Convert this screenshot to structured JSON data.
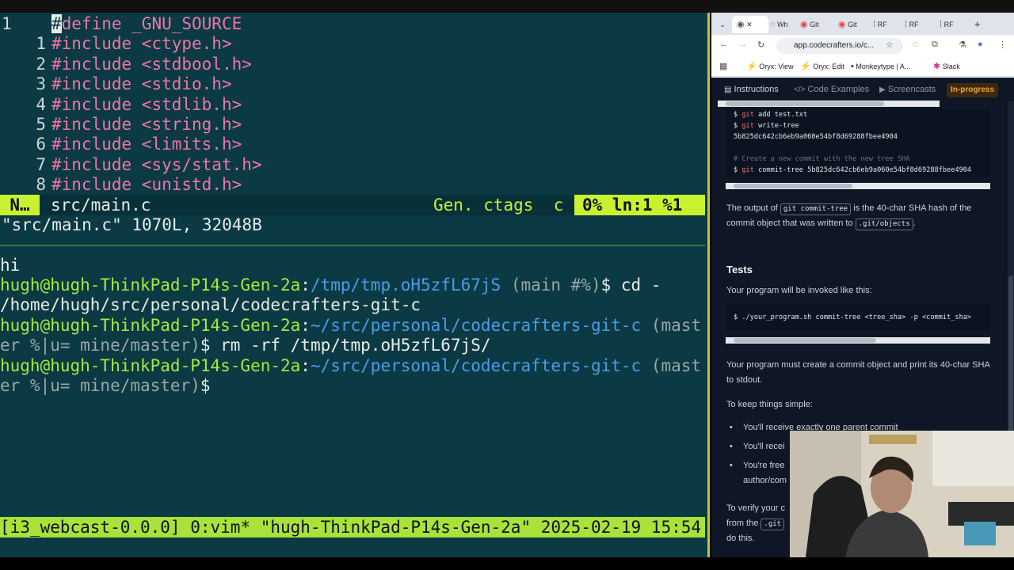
{
  "terminal": {
    "code_lines": [
      {
        "num": "1",
        "text": "#define _GNU_SOURCE",
        "first": true
      },
      {
        "num": "1",
        "directive": "#include",
        "arg": " <ctype.h>"
      },
      {
        "num": "2",
        "directive": "#include",
        "arg": " <stdbool.h>"
      },
      {
        "num": "3",
        "directive": "#include",
        "arg": " <stdio.h>"
      },
      {
        "num": "4",
        "directive": "#include",
        "arg": " <stdlib.h>"
      },
      {
        "num": "5",
        "directive": "#include",
        "arg": " <string.h>"
      },
      {
        "num": "6",
        "directive": "#include",
        "arg": " <limits.h>"
      },
      {
        "num": "7",
        "directive": "#include",
        "arg": " <sys/stat.h>"
      },
      {
        "num": "8",
        "directive": "#include",
        "arg": " <unistd.h>"
      }
    ],
    "statusline": {
      "mode": "N…",
      "file": "src/main.c",
      "right": "Gen. ctags  c",
      "pos": "0% ln:1 %1"
    },
    "cmdline": "\"src/main.c\" 1070L, 32048B",
    "shell": {
      "line_hi": "hi",
      "p1_user": "hugh@hugh-ThinkPad-P14s-Gen-2a",
      "p1_sep": ":",
      "p1_path": "/tmp/tmp.oH5zfL67jS",
      "p1_branch": " (main #%)",
      "p1_cmd": "$ cd -",
      "out1": "/home/hugh/src/personal/codecrafters-git-c",
      "p2_user": "hugh@hugh-ThinkPad-P14s-Gen-2a",
      "p2_sep": ":",
      "p2_path": "~/src/personal/codecrafters-git-c",
      "p2_branch": " (mast",
      "p2_cont": "er %|u= mine/master)",
      "p2_cmd": "$ rm -rf /tmp/tmp.oH5zfL67jS/",
      "p3_user": "hugh@hugh-ThinkPad-P14s-Gen-2a",
      "p3_sep": ":",
      "p3_path": "~/src/personal/codecrafters-git-c",
      "p3_branch": " (mast",
      "p3_cont": "er %|u= mine/master)",
      "p3_cmd": "$"
    },
    "tmux_status": "[i3_webcast-0.0.0] 0:vim* \"hugh-ThinkPad-P14s-Gen-2a\" 2025-02-19 15:54"
  },
  "browser": {
    "tabs": [
      "Wh",
      "Git",
      "Git",
      "RF",
      "RF",
      "RF"
    ],
    "new_tab": "+",
    "url": "app.codecrafters.io/c...",
    "bookmarks": [
      "Oryx: View",
      "Oryx: Edit",
      "Monkeytype | A...",
      "Slack"
    ],
    "page_tabs": [
      "Instructions",
      "Code Examples",
      "Screencasts"
    ],
    "status_badge": "In-progress",
    "code1": [
      {
        "kind": "cmd",
        "prefix": "$ ",
        "git": "git",
        "rest": " add test.txt"
      },
      {
        "kind": "cmd",
        "prefix": "$ ",
        "git": "git",
        "rest": " write-tree"
      },
      {
        "kind": "out",
        "text": "5b825dc642cb6eb9a060e54bf8d69288fbee4904"
      },
      {
        "kind": "blank",
        "text": ""
      },
      {
        "kind": "comment",
        "text": "# Create a new commit with the new tree SHA"
      },
      {
        "kind": "cmd",
        "prefix": "$ ",
        "git": "git",
        "rest": " commit-tree 5b825dc642cb6eb9a060e54bf8d69288fbee4904"
      }
    ],
    "para1_a": "The output of ",
    "para1_code": "git commit-tree",
    "para1_b": " is the 40-char SHA hash of the commit object that was written to ",
    "para1_code2": ".git/objects",
    "para1_c": ".",
    "tests_heading": "Tests",
    "tests_intro": "Your program will be invoked like this:",
    "invocation": "$ ./your_program.sh commit-tree <tree_sha> -p <commit_sha>",
    "para2": "Your program must create a commit object and print its 40-char SHA to stdout.",
    "para3": "To keep things simple:",
    "bullets": [
      "You'll receive exactly one parent commit",
      "You'll recei",
      "You're free",
      "author/com"
    ],
    "para4_a": "To verify your c",
    "para4_b": "from the ",
    "para4_code": ".git",
    "para4_c": "do this."
  }
}
